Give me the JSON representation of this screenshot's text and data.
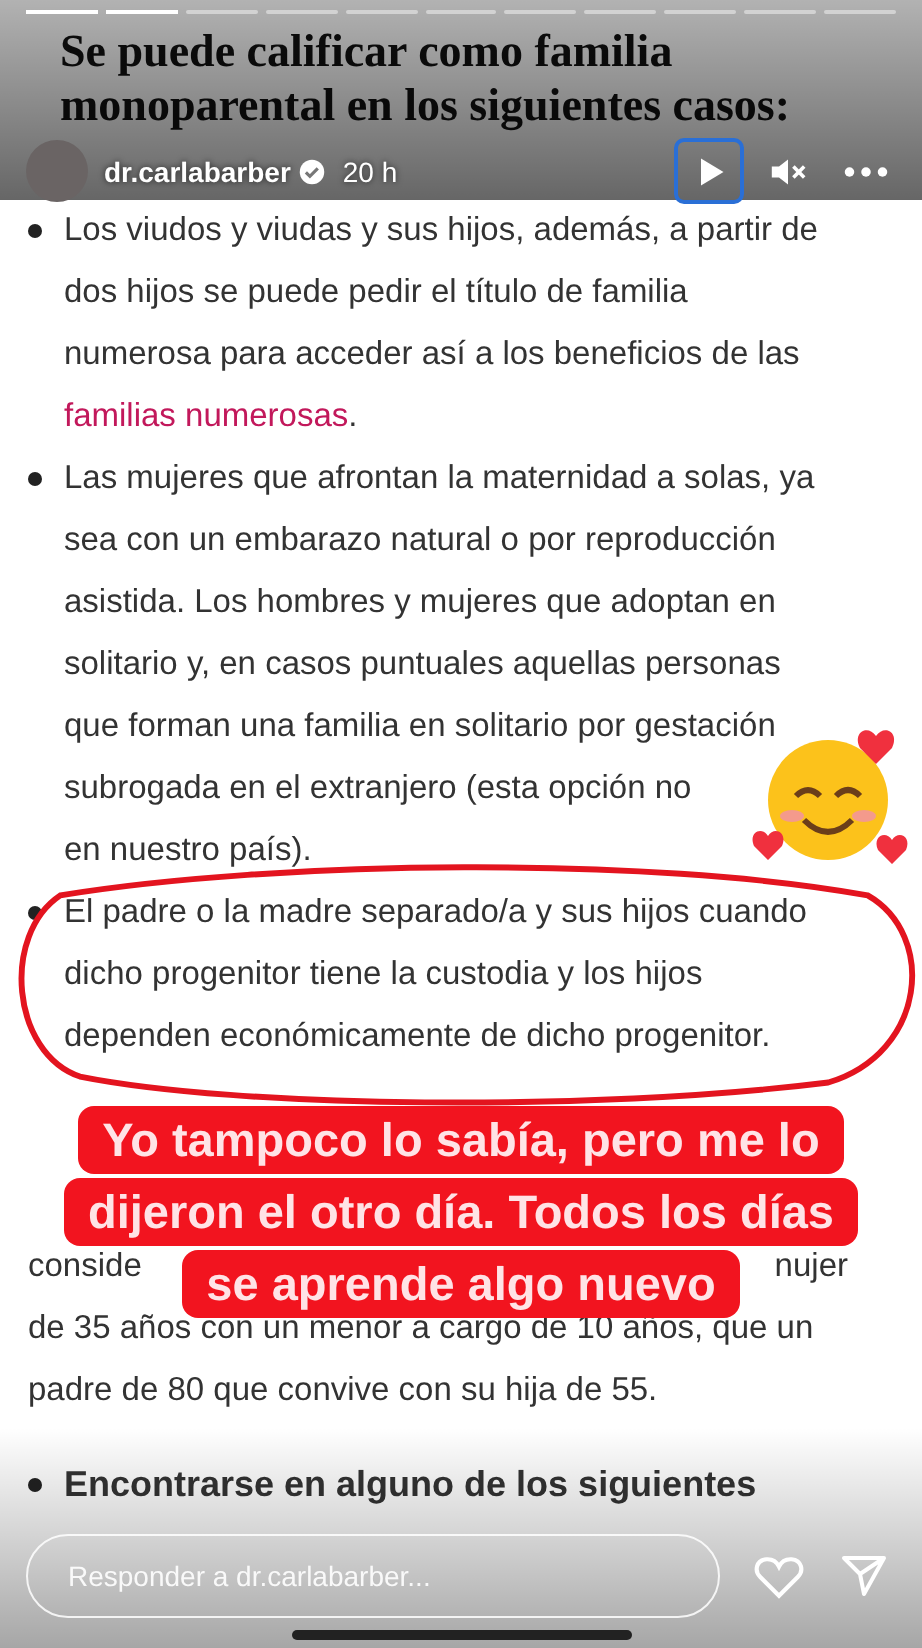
{
  "story": {
    "segments": [
      {
        "level": 1
      },
      {
        "level": 1
      },
      {
        "level": 0
      },
      {
        "level": 0
      },
      {
        "level": 0
      },
      {
        "level": 0
      },
      {
        "level": 0
      },
      {
        "level": 0
      },
      {
        "level": 0
      },
      {
        "level": 0
      },
      {
        "level": 0
      }
    ],
    "header": {
      "username": "dr.carlabarber",
      "verified": true,
      "time": "20 h",
      "play_focused": true,
      "muted": true
    },
    "document": {
      "heading_lines": [
        "Se puede calificar como familia",
        "monoparental en los siguientes casos:"
      ],
      "bullets": [
        {
          "lines": [
            "Los viudos y viudas y sus hijos, además, a partir de",
            "dos hijos se puede pedir el título de familia",
            "numerosa para acceder así a los beneficios de las"
          ],
          "link": "familias numerosas",
          "after_link": "."
        },
        {
          "lines": [
            "Las mujeres que afrontan la maternidad a solas, ya",
            "sea con un embarazo natural o por reproducción",
            "asistida. Los hombres y mujeres que adoptan en",
            "solitario y, en casos puntuales aquellas personas",
            "que forman una familia en solitario por gestación",
            "subrogada en el extranjero (esta opción no",
            "en nuestro país)."
          ]
        },
        {
          "lines": [
            "El padre o la madre separado/a y sus hijos cuando",
            "dicho progenitor tiene la custodia y los hijos",
            "dependen económicamente de dicho progenitor."
          ]
        }
      ],
      "partial_line": {
        "left": "conside",
        "right": "nujer"
      },
      "paragraph_lines": [
        "de 35 años con un menor a cargo de 10 años, que un",
        "padre de 80 que convive con su hija de 55."
      ],
      "last_bullet": "Encontrarse en alguno de los siguientes"
    },
    "caption_lines": [
      "Yo tampoco lo sabía, pero me lo",
      "dijeron el otro día. Todos los días",
      "se aprende algo nuevo"
    ],
    "reply": {
      "placeholder": "Responder a dr.carlabarber..."
    }
  }
}
